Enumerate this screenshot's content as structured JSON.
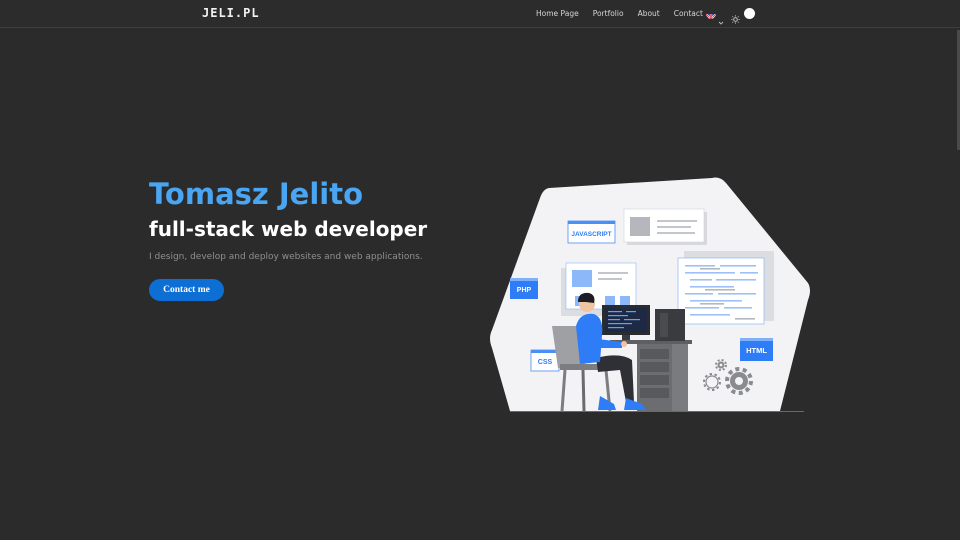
{
  "header": {
    "logo": "JELI.PL",
    "nav": [
      "Home Page",
      "Portfolio",
      "About",
      "Contact"
    ],
    "language_icon": "uk-flag-icon",
    "theme_icon": "sun-icon"
  },
  "hero": {
    "name": "Tomasz Jelito",
    "role": "full-stack web developer",
    "description": "I design, develop and deploy websites and web applications.",
    "cta_label": "Contact me"
  },
  "illustration": {
    "labels": {
      "javascript": "JAVASCRIPT",
      "php": "PHP",
      "css": "CSS",
      "html": "HTML"
    }
  },
  "colors": {
    "background": "#2b2b2b",
    "accent_blue": "#4aa6f3",
    "button_blue": "#0d6fd3",
    "tag_blue": "#2e7cf6"
  }
}
